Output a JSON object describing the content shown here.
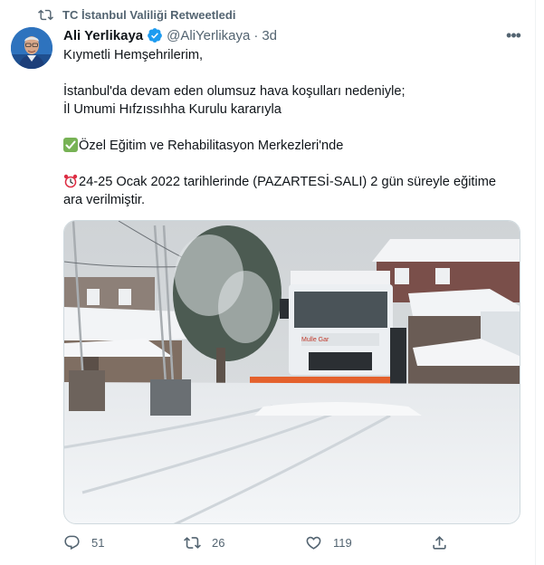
{
  "retweet_context": "TC İstanbul Valiliği Retweetledi",
  "author": {
    "name": "Ali Yerlikaya",
    "handle": "@AliYerlikaya",
    "time": "3d"
  },
  "tweet": {
    "line1": "Kıymetli Hemşehrilerim,",
    "line2a": "İstanbul'da devam eden olumsuz hava koşulları nedeniyle;",
    "line2b": "İl Umumi Hıfzıssıhha Kurulu kararıyla",
    "line3": "Özel Eğitim ve Rehabilitasyon Merkezleri'nde",
    "line4a": "24-25 Ocak 2022 tarihlerinde (PAZARTESİ-SALI) 2 gün süreyle eğitime",
    "line4b": "ara verilmiştir."
  },
  "truck_logo_text": "Mulle Gar",
  "actions": {
    "replies": "51",
    "retweets": "26",
    "likes": "119"
  },
  "icons": {
    "retweet": "retweet-icon",
    "verified": "verified-badge-icon",
    "more": "more-options-icon",
    "check": "check-mark-emoji",
    "alarm": "alarm-clock-emoji",
    "reply": "reply-icon",
    "like": "like-icon",
    "share": "share-icon"
  },
  "colors": {
    "verified": "#1d9bf0",
    "secondary_text": "#536471",
    "check_emoji": "#77b255",
    "alarm_emoji": "#dd2e44"
  }
}
